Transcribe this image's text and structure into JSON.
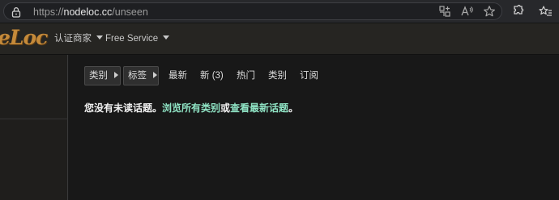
{
  "browser": {
    "url_scheme": "https://",
    "url_host": "nodeloc.cc",
    "url_path": "/unseen"
  },
  "header": {
    "logo_text": "eLoc",
    "menu_certified": "认证商家",
    "menu_free_service": "Free Service"
  },
  "filters": {
    "category_label": "类别",
    "tags_label": "标签"
  },
  "nav": {
    "latest": "最新",
    "new": "新 (3)",
    "top": "热门",
    "categories": "类别",
    "subscribed": "订阅"
  },
  "message": {
    "prefix": "您没有未读话题。",
    "link_browse": "浏览所有类别",
    "connector": "或",
    "link_latest": "查看最新话题",
    "suffix": "。"
  },
  "colors": {
    "accent_link": "#8fe3c4",
    "logo": "#c58a3a",
    "background": "#181818"
  }
}
